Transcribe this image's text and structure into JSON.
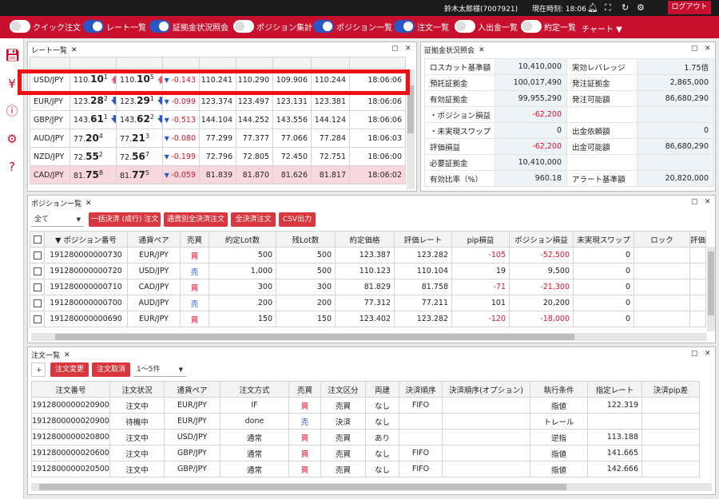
{
  "topbar": {
    "user": "鈴木太郎様(7007921)",
    "time": "現在時刻: 18:06",
    "logout": "ログアウト"
  },
  "nav": {
    "toggles": [
      {
        "label": "クイック注文",
        "on": false
      },
      {
        "label": "レート一覧",
        "on": true
      },
      {
        "label": "証拠金状況照会",
        "on": true
      },
      {
        "label": "ポジション集計",
        "on": false
      },
      {
        "label": "ポジション一覧",
        "on": true
      },
      {
        "label": "注文一覧",
        "on": true
      },
      {
        "label": "入出金一覧",
        "on": false
      },
      {
        "label": "約定一覧",
        "on": false
      }
    ],
    "chart": "チャート"
  },
  "rate_panel": {
    "tab": "レート一覧",
    "rows": [
      {
        "pair": "USD/JPY",
        "bid_pre": "110.",
        "bid_big": "10",
        "bid_sup": "1",
        "bid_dir": "up",
        "ask_pre": "110.",
        "ask_big": "10",
        "ask_sup": "5",
        "ask_dir": "up",
        "change": "-0.143",
        "c1": "110.241",
        "c2": "110.290",
        "c3": "109.906",
        "c4": "110.244",
        "time": "18:06:06"
      },
      {
        "pair": "EUR/JPY",
        "bid_pre": "123.",
        "bid_big": "28",
        "bid_sup": "2",
        "bid_dir": "down",
        "ask_pre": "123.",
        "ask_big": "29",
        "ask_sup": "1",
        "ask_dir": "down",
        "change": "-0.099",
        "c1": "123.374",
        "c2": "123.497",
        "c3": "123.131",
        "c4": "123.381",
        "time": "18:06:06"
      },
      {
        "pair": "GBP/JPY",
        "bid_pre": "143.",
        "bid_big": "61",
        "bid_sup": "1",
        "bid_dir": "down",
        "ask_pre": "143.",
        "ask_big": "62",
        "ask_sup": "2",
        "ask_dir": "down",
        "change": "-0.513",
        "c1": "144.104",
        "c2": "144.252",
        "c3": "143.556",
        "c4": "144.124",
        "time": "18:06:06"
      },
      {
        "pair": "AUD/JPY",
        "bid_pre": "77.",
        "bid_big": "20",
        "bid_sup": "4",
        "bid_dir": "",
        "ask_pre": "77.",
        "ask_big": "21",
        "ask_sup": "3",
        "ask_dir": "",
        "change": "-0.080",
        "c1": "77.299",
        "c2": "77.377",
        "c3": "77.066",
        "c4": "77.284",
        "time": "18:06:03"
      },
      {
        "pair": "NZD/JPY",
        "bid_pre": "72.",
        "bid_big": "55",
        "bid_sup": "2",
        "bid_dir": "",
        "ask_pre": "72.",
        "ask_big": "56",
        "ask_sup": "7",
        "ask_dir": "",
        "change": "-0.199",
        "c1": "72.796",
        "c2": "72.805",
        "c3": "72.450",
        "c4": "72.751",
        "time": "18:06:00"
      },
      {
        "pair": "CAD/JPY",
        "bid_pre": "81.",
        "bid_big": "75",
        "bid_sup": "8",
        "bid_dir": "",
        "ask_pre": "81.",
        "ask_big": "77",
        "ask_sup": "5",
        "ask_dir": "",
        "change": "-0.059",
        "c1": "81.839",
        "c2": "81.870",
        "c3": "81.626",
        "c4": "81.817",
        "time": "18:06:02"
      }
    ]
  },
  "margin_panel": {
    "tab": "証拠金状況照会",
    "rows": [
      {
        "l1": "ロスカット基準額",
        "v1": "10,410,000",
        "l2": "実効レバレッジ",
        "v2": "1.75倍"
      },
      {
        "l1": "預託証拠金",
        "v1": "100,017,490",
        "l2": "発注証拠金",
        "v2": "2,865,000"
      },
      {
        "l1": "有効証拠金",
        "v1": "99,955,290",
        "l2": "発注可能額",
        "v2": "86,680,290"
      },
      {
        "l1": "・ポジション損益",
        "v1": "-62,200",
        "l2": "",
        "v2": ""
      },
      {
        "l1": "・未実現スワップ",
        "v1": "0",
        "l2": "出金依頼額",
        "v2": "0"
      },
      {
        "l1": "評価損益",
        "v1": "-62,200",
        "l2": "出金可能額",
        "v2": "86,680,290"
      },
      {
        "l1": "必要証拠金",
        "v1": "10,410,000",
        "l2": "",
        "v2": ""
      },
      {
        "l1": "有効比率（%）",
        "v1": "960.18",
        "l2": "アラート基準額",
        "v2": "20,820,000"
      }
    ]
  },
  "position_panel": {
    "tab": "ポジション一覧",
    "filter": "全て",
    "buttons": [
      "一括決済 (成行) 注文",
      "通貨別全決済注文",
      "全決済注文",
      "CSV出力"
    ],
    "headers": [
      "▼ ポジション番号",
      "通貨ペア",
      "売買",
      "約定Lot数",
      "残Lot数",
      "約定価格",
      "評価レート",
      "pip損益",
      "ポジション損益",
      "未実現スワップ",
      "ロック",
      "評価損"
    ],
    "rows": [
      {
        "id": "191280000000730",
        "pair": "EUR/JPY",
        "side": "買",
        "lot": "500",
        "rem": "500",
        "price": "123.387",
        "rate": "123.282",
        "pip": "-105",
        "pl": "-52,500",
        "swap": "0"
      },
      {
        "id": "191280000000720",
        "pair": "USD/JPY",
        "side": "売",
        "lot": "1,000",
        "rem": "500",
        "price": "110.123",
        "rate": "110.104",
        "pip": "19",
        "pl": "9,500",
        "swap": "0"
      },
      {
        "id": "191280000000710",
        "pair": "CAD/JPY",
        "side": "買",
        "lot": "300",
        "rem": "300",
        "price": "81.829",
        "rate": "81.758",
        "pip": "-71",
        "pl": "-21,300",
        "swap": "0"
      },
      {
        "id": "191280000000700",
        "pair": "AUD/JPY",
        "side": "売",
        "lot": "200",
        "rem": "200",
        "price": "77.312",
        "rate": "77.211",
        "pip": "101",
        "pl": "20,200",
        "swap": "0"
      },
      {
        "id": "191280000000690",
        "pair": "EUR/JPY",
        "side": "買",
        "lot": "150",
        "rem": "150",
        "price": "123.402",
        "rate": "123.282",
        "pip": "-120",
        "pl": "-18,000",
        "swap": "0"
      }
    ]
  },
  "order_panel": {
    "tab": "注文一覧",
    "plus": "+",
    "buttons": [
      "注文変更",
      "注文取消"
    ],
    "range": "1～5件",
    "headers": [
      "注文番号",
      "注文状況",
      "通貨ペア",
      "注文方式",
      "売買",
      "注文区分",
      "両建",
      "決済順序",
      "決済順序(オプション)",
      "執行条件",
      "指定レート",
      "決済pip差"
    ],
    "rows": [
      {
        "id": "1912800000020900",
        "status": "注文中",
        "pair": "EUR/JPY",
        "type": "IF",
        "side": "買",
        "cls": "売買",
        "both": "なし",
        "order": "FIFO",
        "opt": "",
        "cond": "指値",
        "rate": "122.319"
      },
      {
        "id": "1912800000020900",
        "status": "待機中",
        "pair": "EUR/JPY",
        "type": "done",
        "side": "売",
        "cls": "決済",
        "both": "なし",
        "order": "",
        "opt": "",
        "cond": "トレール",
        "rate": ""
      },
      {
        "id": "1912800000020800",
        "status": "注文中",
        "pair": "USD/JPY",
        "type": "通常",
        "side": "買",
        "cls": "売買",
        "both": "あり",
        "order": "",
        "opt": "",
        "cond": "逆指",
        "rate": "113.188"
      },
      {
        "id": "1912800000020600",
        "status": "注文中",
        "pair": "GBP/JPY",
        "type": "通常",
        "side": "買",
        "cls": "売買",
        "both": "なし",
        "order": "FIFO",
        "opt": "",
        "cond": "指値",
        "rate": "141.665"
      },
      {
        "id": "1912800000020500",
        "status": "注文中",
        "pair": "GBP/JPY",
        "type": "通常",
        "side": "買",
        "cls": "売買",
        "both": "なし",
        "order": "FIFO",
        "opt": "",
        "cond": "指値",
        "rate": "142.666"
      }
    ]
  }
}
